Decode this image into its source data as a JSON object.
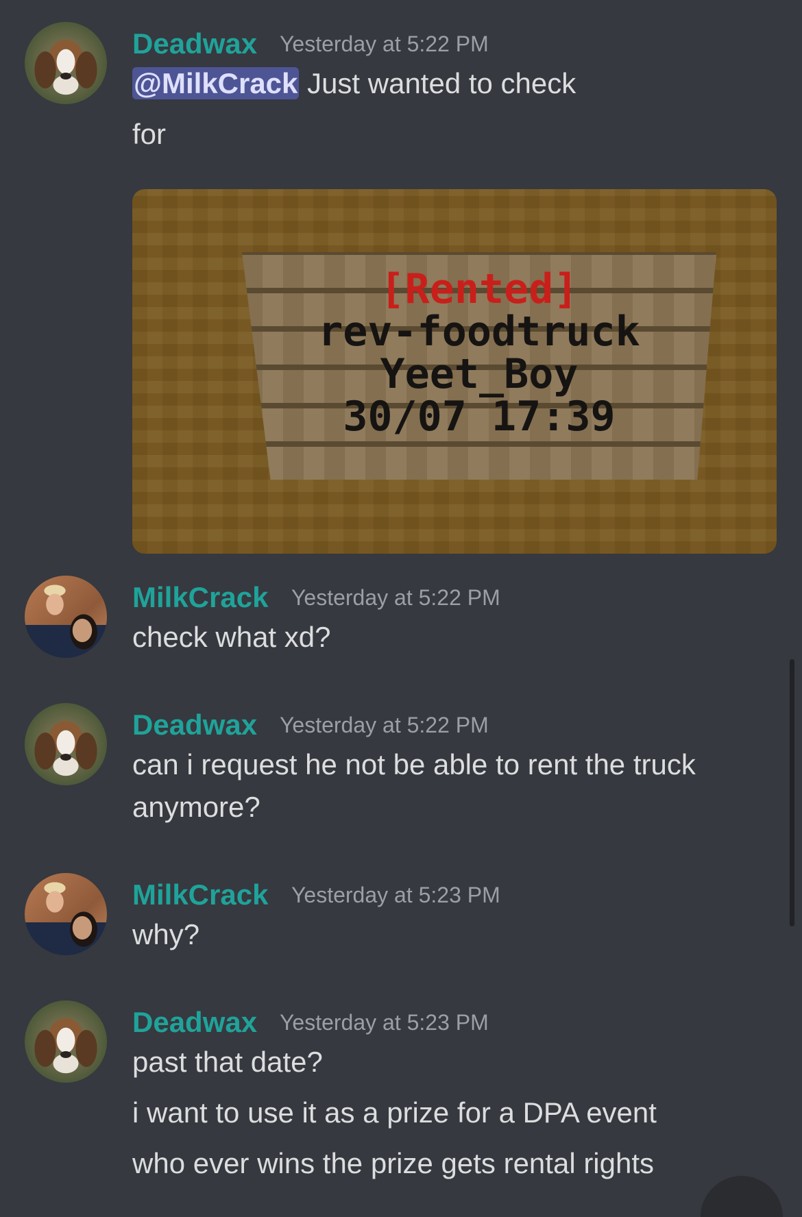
{
  "messages": [
    {
      "author": "Deadwax",
      "timestamp": "Yesterday at 5:22 PM",
      "avatar": "beagle-avatar",
      "mention": "@MilkCrack",
      "lines": [
        "Just wanted to check",
        "for"
      ],
      "embed": {
        "sign_lines": [
          "[Rented]",
          "rev-foodtruck",
          "Yeet_Boy",
          "30/07 17:39"
        ]
      }
    },
    {
      "author": "MilkCrack",
      "timestamp": "Yesterday at 5:22 PM",
      "avatar": "photo-avatar",
      "lines": [
        "check what xd?"
      ]
    },
    {
      "author": "Deadwax",
      "timestamp": "Yesterday at 5:22 PM",
      "avatar": "beagle-avatar",
      "lines": [
        "can i request he not be able to rent the truck",
        "anymore?"
      ]
    },
    {
      "author": "MilkCrack",
      "timestamp": "Yesterday at 5:23 PM",
      "avatar": "photo-avatar",
      "lines": [
        "why?"
      ]
    },
    {
      "author": "Deadwax",
      "timestamp": "Yesterday at 5:23 PM",
      "avatar": "beagle-avatar",
      "lines": [
        "past that date?",
        "i want to use it as a prize for a DPA event",
        "who ever wins the prize gets rental rights"
      ]
    }
  ],
  "colors": {
    "background": "#36393f",
    "username": "#1fa39a",
    "timestamp": "#9ba0a6",
    "message_text": "#dcddde",
    "mention_bg": "#4e5595"
  }
}
